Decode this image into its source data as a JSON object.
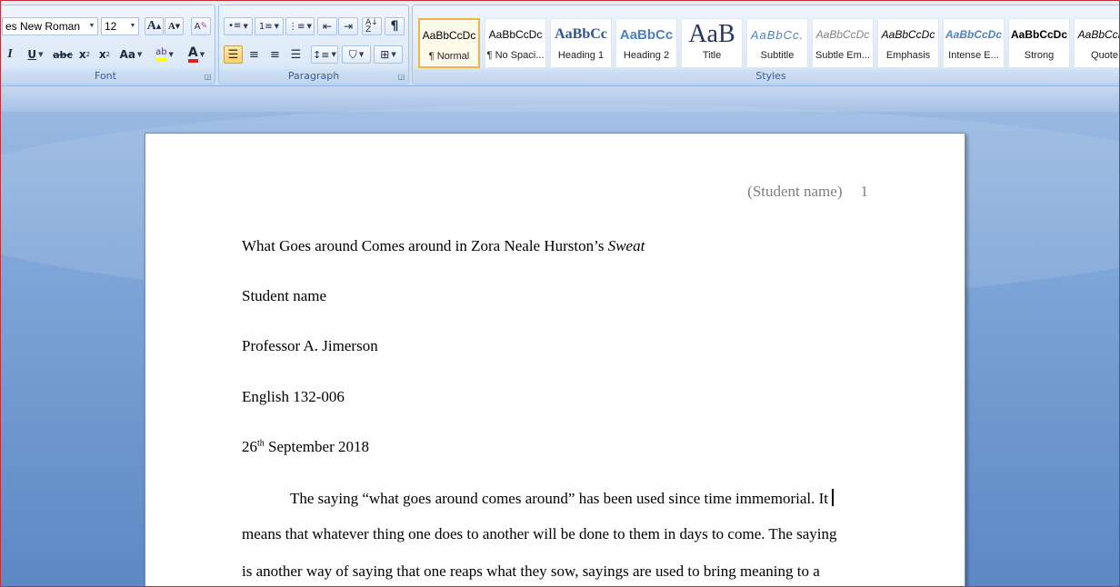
{
  "ribbon": {
    "font_group": {
      "label": "Font",
      "font_name": "es New Roman",
      "font_size": "12",
      "grow_font": "A",
      "shrink_font": "A",
      "clear_format": "A",
      "italic": "I",
      "underline": "U",
      "strikethrough": "abc",
      "subscript": "x",
      "superscript": "x",
      "change_case": "Aa",
      "highlight": "ab",
      "font_color": "A"
    },
    "paragraph_group": {
      "label": "Paragraph",
      "pilcrow": "¶"
    },
    "styles_group": {
      "label": "Styles",
      "styles": [
        {
          "sample": "AaBbCcDc",
          "name": "¶ Normal"
        },
        {
          "sample": "AaBbCcDc",
          "name": "¶ No Spaci..."
        },
        {
          "sample": "AaBbCc",
          "name": "Heading 1"
        },
        {
          "sample": "AaBbCc",
          "name": "Heading 2"
        },
        {
          "sample": "AaB",
          "name": "Title"
        },
        {
          "sample": "AaBbCc.",
          "name": "Subtitle"
        },
        {
          "sample": "AaBbCcDc",
          "name": "Subtle Em..."
        },
        {
          "sample": "AaBbCcDc",
          "name": "Emphasis"
        },
        {
          "sample": "AaBbCcDc",
          "name": "Intense E..."
        },
        {
          "sample": "AaBbCcDc",
          "name": "Strong"
        },
        {
          "sample": "AaBbCcDc",
          "name": "Quote"
        }
      ]
    }
  },
  "document": {
    "header_name": "(Student name)",
    "page_number": "1",
    "title_main": "What Goes around Comes around in Zora Neale Hurston’s ",
    "title_italic": "Sweat",
    "student": "Student name",
    "professor": "Professor A. Jimerson",
    "course": "English 132-006",
    "date_day": "26",
    "date_suffix": "th",
    "date_rest": " September 2018",
    "body_lines": [
      "The saying “what goes around comes around” has been used since time immemorial. It",
      "means that whatever thing one does to another will be done to them in days to come. The saying",
      "is another way of saying that one reaps what they sow, sayings are used to bring meaning to a"
    ]
  },
  "colors": {
    "ribbon_bg": "#dbe7f6",
    "workspace_bg": "#7fa6d8",
    "selected_style_border": "#f2b545",
    "header_text": "#808080",
    "highlight_yellow": "#ffff00",
    "font_color_red": "#e0201a"
  }
}
